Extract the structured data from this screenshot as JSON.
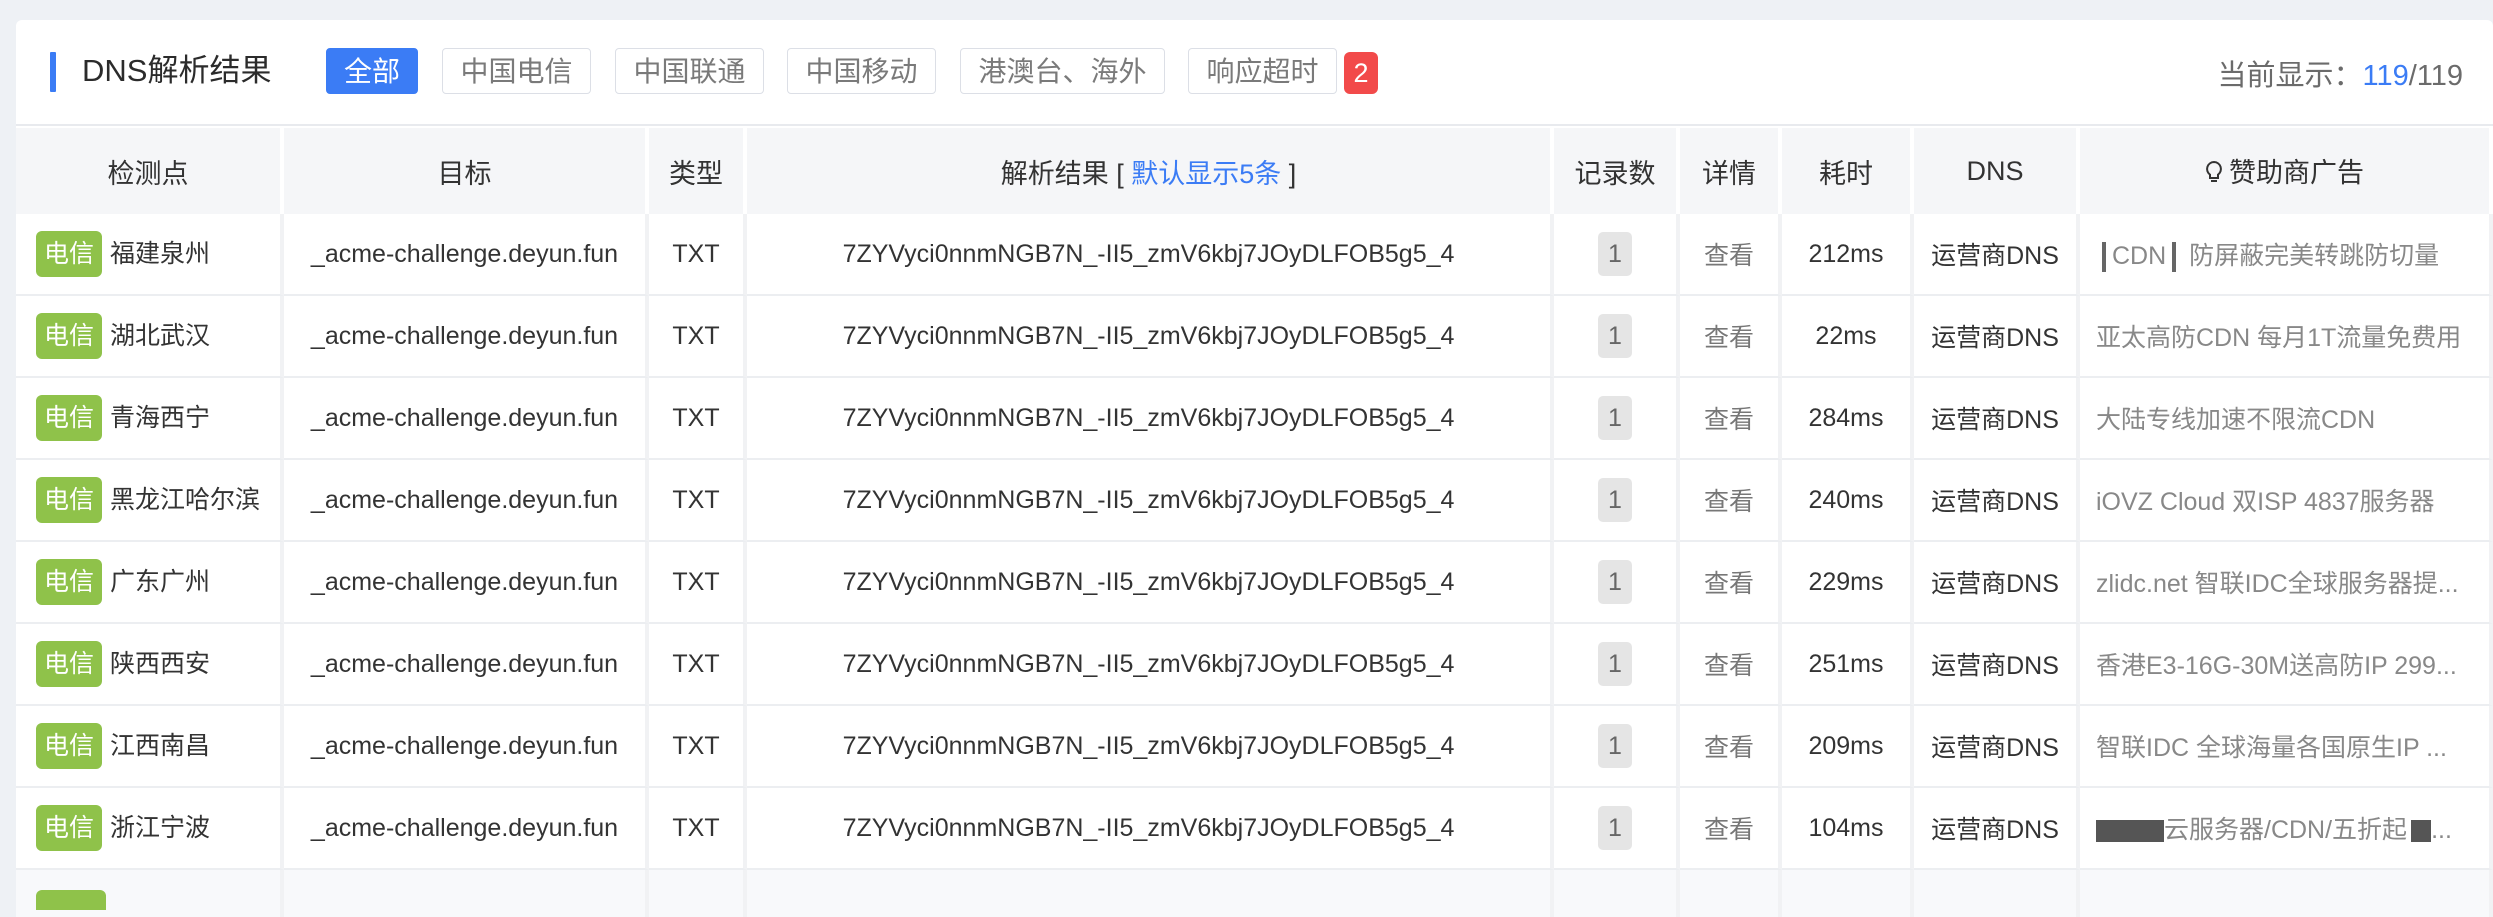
{
  "header": {
    "title": "DNS解析结果",
    "filters": [
      "全部",
      "中国电信",
      "中国联通",
      "中国移动",
      "港澳台、海外",
      "响应超时"
    ],
    "active_filter": "全部",
    "timeout_count": "2",
    "current_label": "当前显示：",
    "current_shown": "119",
    "current_total": "/119"
  },
  "table": {
    "columns": {
      "location": "检测点",
      "target": "目标",
      "type": "类型",
      "result": "解析结果 [",
      "result_hint": "默认显示5条",
      "result_close": "]",
      "records": "记录数",
      "detail": "详情",
      "time": "耗时",
      "dns": "DNS",
      "ad": "赞助商广告"
    },
    "rows": [
      {
        "isp": "电信",
        "location": "福建泉州",
        "target": "_acme-challenge.deyun.fun",
        "type": "TXT",
        "result": "7ZYVyci0nnmNGB7N_-II5_zmV6kbj7JOyDLFOB5g5_4",
        "records": "1",
        "detail": "查看",
        "time": "212ms",
        "dns": "运营商DNS",
        "ad": "CDN"
      },
      {
        "isp": "电信",
        "location": "湖北武汉",
        "target": "_acme-challenge.deyun.fun",
        "type": "TXT",
        "result": "7ZYVyci0nnmNGB7N_-II5_zmV6kbj7JOyDLFOB5g5_4",
        "records": "1",
        "detail": "查看",
        "time": "22ms",
        "dns": "运营商DNS",
        "ad": "亚太高防CDN 每月1T流量免费用"
      },
      {
        "isp": "电信",
        "location": "青海西宁",
        "target": "_acme-challenge.deyun.fun",
        "type": "TXT",
        "result": "7ZYVyci0nnmNGB7N_-II5_zmV6kbj7JOyDLFOB5g5_4",
        "records": "1",
        "detail": "查看",
        "time": "284ms",
        "dns": "运营商DNS",
        "ad": "大陆专线加速不限流CDN"
      },
      {
        "isp": "电信",
        "location": "黑龙江哈尔滨",
        "target": "_acme-challenge.deyun.fun",
        "type": "TXT",
        "result": "7ZYVyci0nnmNGB7N_-II5_zmV6kbj7JOyDLFOB5g5_4",
        "records": "1",
        "detail": "查看",
        "time": "240ms",
        "dns": "运营商DNS",
        "ad": "iOVZ Cloud 双ISP 4837服务器"
      },
      {
        "isp": "电信",
        "location": "广东广州",
        "target": "_acme-challenge.deyun.fun",
        "type": "TXT",
        "result": "7ZYVyci0nnmNGB7N_-II5_zmV6kbj7JOyDLFOB5g5_4",
        "records": "1",
        "detail": "查看",
        "time": "229ms",
        "dns": "运营商DNS",
        "ad": "zlidc.net 智联IDC全球服务器提..."
      },
      {
        "isp": "电信",
        "location": "陕西西安",
        "target": "_acme-challenge.deyun.fun",
        "type": "TXT",
        "result": "7ZYVyci0nnmNGB7N_-II5_zmV6kbj7JOyDLFOB5g5_4",
        "records": "1",
        "detail": "查看",
        "time": "251ms",
        "dns": "运营商DNS",
        "ad": "香港E3-16G-30M送高防IP 299..."
      },
      {
        "isp": "电信",
        "location": "江西南昌",
        "target": "_acme-challenge.deyun.fun",
        "type": "TXT",
        "result": "7ZYVyci0nnmNGB7N_-II5_zmV6kbj7JOyDLFOB5g5_4",
        "records": "1",
        "detail": "查看",
        "time": "209ms",
        "dns": "运营商DNS",
        "ad": "智联IDC 全球海量各国原生IP ..."
      },
      {
        "isp": "电信",
        "location": "浙江宁波",
        "target": "_acme-challenge.deyun.fun",
        "type": "TXT",
        "result": "7ZYVyci0nnmNGB7N_-II5_zmV6kbj7JOyDLFOB5g5_4",
        "records": "1",
        "detail": "查看",
        "time": "104ms",
        "dns": "运营商DNS",
        "ad": "云服务器/CDN/五折起"
      }
    ],
    "first_ad_suffix": "防屏蔽完美转跳防切量"
  }
}
